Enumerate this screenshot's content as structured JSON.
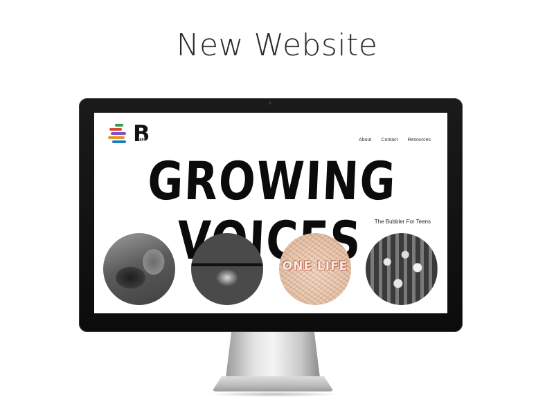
{
  "title": "New Website",
  "site": {
    "nav": [
      "About",
      "Contact",
      "Resources"
    ],
    "hero": "GROWING VOICES",
    "tagline": "The Bubbler For Teens",
    "brand_letter": "B",
    "logo_colors": [
      "#2f9e4a",
      "#d94a3b",
      "#8a4fbf",
      "#e0962b",
      "#1c7dbf"
    ],
    "images": [
      {
        "name": "photo-person-hunched",
        "caption": ""
      },
      {
        "name": "photo-computer-library",
        "caption": ""
      },
      {
        "name": "artwork-one-life",
        "caption": "ONE LIFE"
      },
      {
        "name": "photo-group-signs",
        "caption": ""
      }
    ]
  }
}
